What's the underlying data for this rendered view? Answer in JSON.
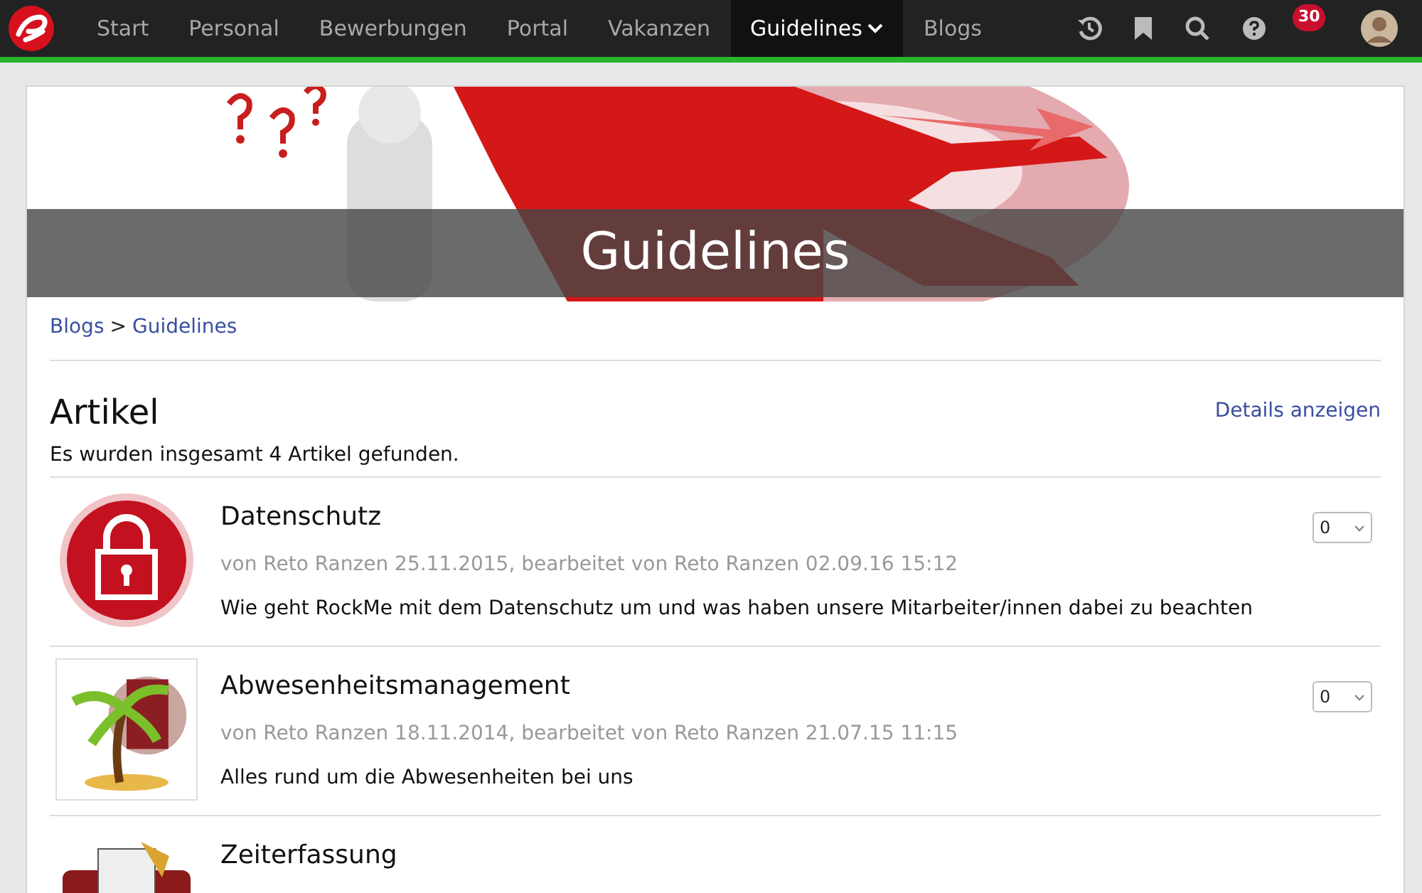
{
  "navbar": {
    "items": [
      {
        "label": "Start",
        "selected": false,
        "dropdown": false
      },
      {
        "label": "Personal",
        "selected": false,
        "dropdown": false
      },
      {
        "label": "Bewerbungen",
        "selected": false,
        "dropdown": false
      },
      {
        "label": "Portal",
        "selected": false,
        "dropdown": false
      },
      {
        "label": "Vakanzen",
        "selected": false,
        "dropdown": false
      },
      {
        "label": "Guidelines",
        "selected": true,
        "dropdown": true
      },
      {
        "label": "Blogs",
        "selected": false,
        "dropdown": false
      }
    ],
    "notification_count": "30"
  },
  "banner": {
    "title": "Guidelines"
  },
  "breadcrumb": [
    {
      "label": "Blogs"
    },
    {
      "label": "Guidelines"
    }
  ],
  "breadcrumb_separator": ">",
  "section": {
    "title": "Artikel",
    "details_link": "Details anzeigen",
    "count_text": "Es wurden insgesamt 4 Artikel gefunden."
  },
  "articles": [
    {
      "title": "Datenschutz",
      "meta": "von Reto Ranzen 25.11.2015, bearbeitet von Reto Ranzen 02.09.16 15:12",
      "description": "Wie geht RockMe mit dem Datenschutz um und was haben unsere Mitarbeiter/innen dabei zu beachten",
      "rating": "0"
    },
    {
      "title": "Abwesenheitsmanagement",
      "meta": "von Reto Ranzen 18.11.2014, bearbeitet von Reto Ranzen 21.07.15 11:15",
      "description": "Alles rund um die Abwesenheiten bei uns",
      "rating": "0"
    },
    {
      "title": "Zeiterfassung"
    }
  ]
}
